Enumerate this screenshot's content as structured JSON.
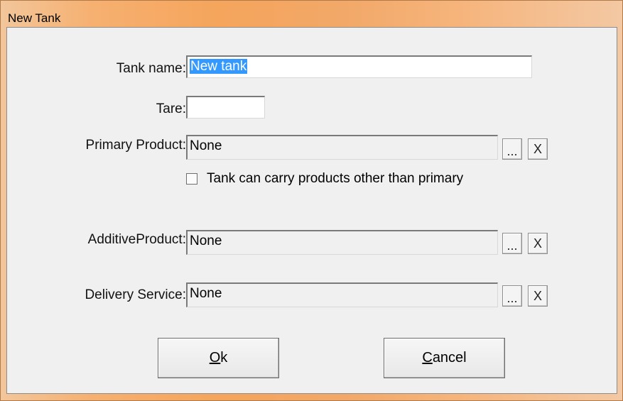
{
  "window": {
    "title": "New Tank"
  },
  "form": {
    "tank_name": {
      "label": "Tank name:",
      "value": "New tank"
    },
    "tare": {
      "label": "Tare:",
      "value": ""
    },
    "primary_product": {
      "label": "Primary Product:",
      "value": "None"
    },
    "carry_other_products": {
      "label": "Tank can carry products other than primary",
      "checked": false
    },
    "additive_product": {
      "label": "AdditiveProduct:",
      "value": "None"
    },
    "delivery_service": {
      "label": "Delivery Service:",
      "value": "None"
    }
  },
  "browse_button_label": "...",
  "clear_button_label": "X",
  "buttons": {
    "ok": {
      "mnemonic": "O",
      "rest": "k"
    },
    "cancel": {
      "mnemonic": "C",
      "rest": "ancel"
    }
  }
}
